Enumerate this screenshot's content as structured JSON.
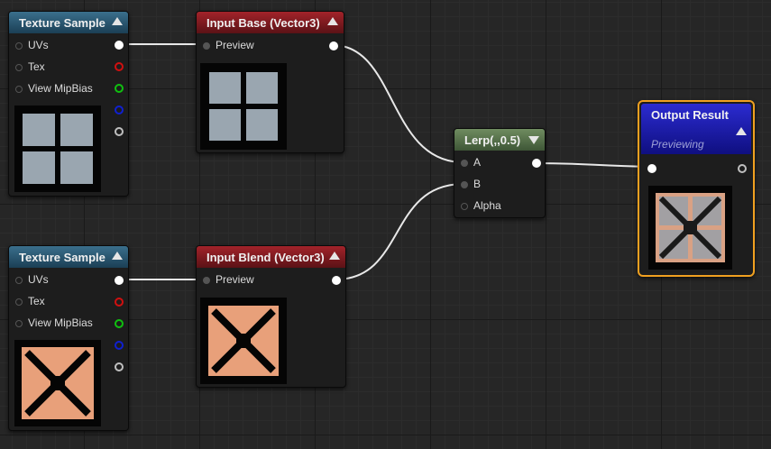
{
  "nodes": {
    "tex1": {
      "title": "Texture Sample",
      "pins": [
        "UVs",
        "Tex",
        "View MipBias"
      ]
    },
    "tex2": {
      "title": "Texture Sample",
      "pins": [
        "UVs",
        "Tex",
        "View MipBias"
      ]
    },
    "input_base": {
      "title": "Input Base (Vector3)",
      "pin": "Preview"
    },
    "input_blend": {
      "title": "Input Blend (Vector3)",
      "pin": "Preview"
    },
    "lerp": {
      "title": "Lerp(,,0.5)",
      "pins": [
        "A",
        "B",
        "Alpha"
      ]
    },
    "output": {
      "title": "Output Result",
      "subtitle": "Previewing"
    }
  },
  "colors": {
    "pin_red": "#d01010",
    "pin_green": "#10c010",
    "pin_blue": "#1020d0",
    "pin_gray": "#bfbfbf",
    "selection": "#f0a020",
    "texture_gray": "#9aa6b0",
    "texture_orange": "#e8a07a"
  },
  "icons": [
    "collapse-arrow-icon",
    "window-texture-icon",
    "x-cross-texture-icon"
  ]
}
